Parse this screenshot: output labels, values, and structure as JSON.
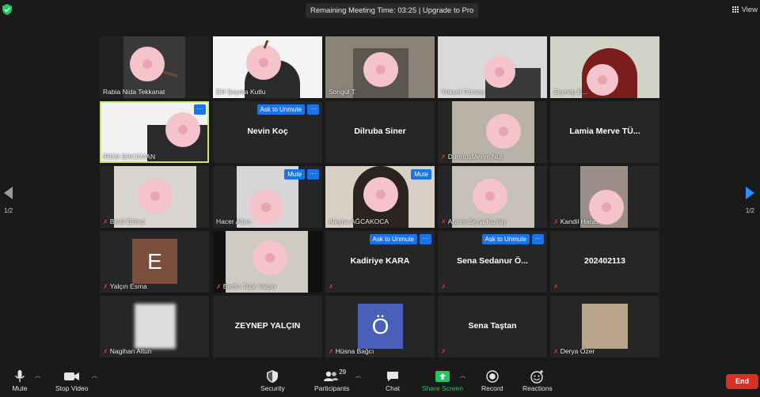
{
  "topbar": {
    "timer_text": "Remaining Meeting Time: 03:25 | Upgrade to Pro",
    "view_label": "View"
  },
  "pager": {
    "left_label": "1/2",
    "right_label": "1/2"
  },
  "tiles": {
    "t0": {
      "name": "Rabia Nida Tekkanat"
    },
    "t1": {
      "name": "Elif Şeyma Kutlu"
    },
    "t2": {
      "name": "Songül T."
    },
    "t3": {
      "name": "Yüksel Gürsoy"
    },
    "t4": {
      "name": "Zeynep E..."
    },
    "t5": {
      "name": "İREM ERCEMAN"
    },
    "t6": {
      "name": "Nevin Koç",
      "button": "Ask to Unmute",
      "more": "···"
    },
    "t7": {
      "name": "Dilruba Siner"
    },
    "t8": {
      "name": "DurmuşMerve Nur"
    },
    "t9": {
      "name": "Lamia Merve TÜ..."
    },
    "t10": {
      "name": "Betül Ekinci"
    },
    "t11": {
      "name": "Hacer Altun",
      "button": "Mute",
      "more": "···"
    },
    "t12": {
      "name": "Aleyna AĞCAKOCA",
      "button": "Mute"
    },
    "t13": {
      "name": "Ahsen Sena Kızılay"
    },
    "t14": {
      "name": "Kandil Haras"
    },
    "t15": {
      "name": "Yalçın Esma",
      "letter": "E"
    },
    "t16": {
      "name": "Berfin Türk Yalçın"
    },
    "t17": {
      "name": "Kadiriye KARA",
      "button": "Ask to Unmute",
      "more": "···"
    },
    "t18": {
      "name": "Sena Sedanur Ö...",
      "button": "Ask to Unmute",
      "more": "···"
    },
    "t19": {
      "name": "202402113"
    },
    "t20": {
      "name": "Nagihan Altun"
    },
    "t21": {
      "name": "ZEYNEP YALÇIN"
    },
    "t22": {
      "name": "Hüsna Bağcı",
      "letter": "Ö"
    },
    "t23": {
      "name": "Sena Taştan"
    },
    "t24": {
      "name": "Derya Özer"
    }
  },
  "toolbar": {
    "mute": "Mute",
    "stop_video": "Stop Video",
    "security": "Security",
    "participants": "Participants",
    "participants_count": "29",
    "chat": "Chat",
    "share_screen": "Share Screen",
    "record": "Record",
    "reactions": "Reactions",
    "end": "End"
  },
  "colors": {
    "accent_blue": "#1a73e8",
    "share_green": "#22c55e",
    "end_red": "#d93025",
    "active_speaker": "#c7e86b",
    "muted_red": "#e0443e"
  }
}
